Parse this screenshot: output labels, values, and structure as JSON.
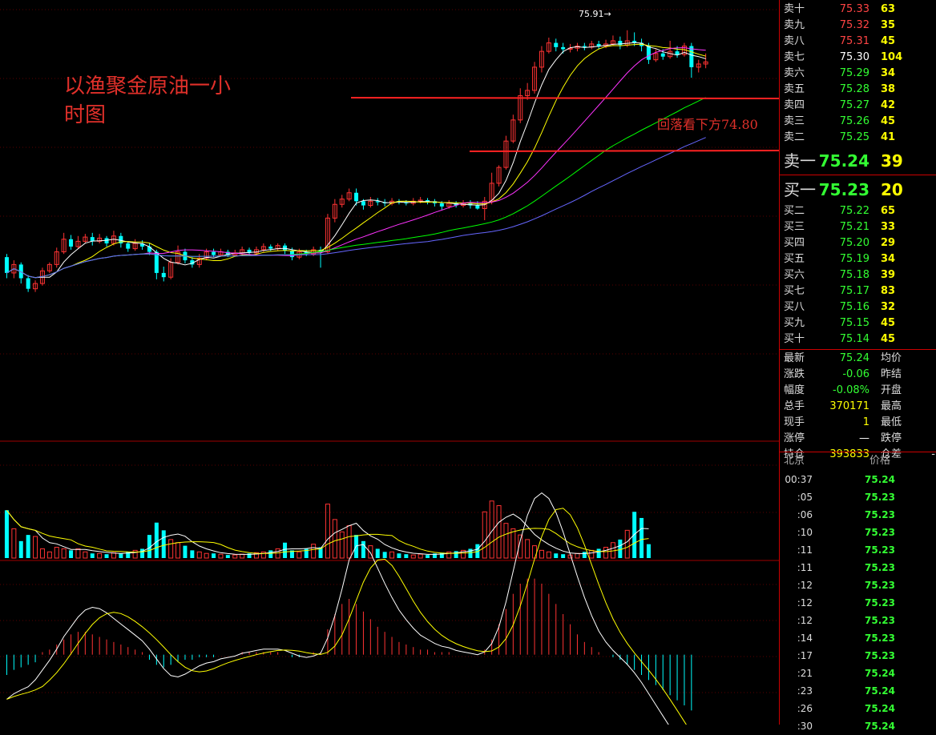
{
  "annotations": {
    "title": "以渔聚金原油一小\n时图",
    "note": "回落看下方74.80",
    "peak_label": "75.91→"
  },
  "colors": {
    "up": "#ff3333",
    "down": "#00ffff",
    "ma5": "#ffffff",
    "ma10": "#ffff00",
    "ma20": "#ff33ff",
    "ma40": "#00ff00",
    "ma60": "#6666ff",
    "arrow": "#ff2222"
  },
  "chart_data": [
    {
      "type": "candlestick",
      "name": "price",
      "candles": [
        [
          75.25,
          75.1,
          75.28,
          75.05
        ],
        [
          75.1,
          75.18,
          75.22,
          75.05
        ],
        [
          75.18,
          75.05,
          75.2,
          75.0
        ],
        [
          75.05,
          74.95,
          75.08,
          74.92
        ],
        [
          74.95,
          75.0,
          75.03,
          74.92
        ],
        [
          75.0,
          75.12,
          75.15,
          74.98
        ],
        [
          75.12,
          75.18,
          75.2,
          75.1
        ],
        [
          75.18,
          75.3,
          75.34,
          75.15
        ],
        [
          75.3,
          75.42,
          75.48,
          75.28
        ],
        [
          75.42,
          75.35,
          75.46,
          75.32
        ],
        [
          75.35,
          75.4,
          75.45,
          75.33
        ],
        [
          75.4,
          75.44,
          75.47,
          75.38
        ],
        [
          75.44,
          75.4,
          75.48,
          75.36
        ],
        [
          75.4,
          75.43,
          75.47,
          75.38
        ],
        [
          75.43,
          75.38,
          75.45,
          75.35
        ],
        [
          75.38,
          75.45,
          75.5,
          75.36
        ],
        [
          75.45,
          75.38,
          75.48,
          75.34
        ],
        [
          75.38,
          75.33,
          75.4,
          75.3
        ],
        [
          75.33,
          75.38,
          75.42,
          75.31
        ],
        [
          75.38,
          75.35,
          75.41,
          75.32
        ],
        [
          75.35,
          75.3,
          75.38,
          75.27
        ],
        [
          75.3,
          75.1,
          75.32,
          75.04
        ],
        [
          75.1,
          75.06,
          75.16,
          75.02
        ],
        [
          75.06,
          75.2,
          75.24,
          75.04
        ],
        [
          75.2,
          75.3,
          75.36,
          75.18
        ],
        [
          75.3,
          75.22,
          75.33,
          75.19
        ],
        [
          75.22,
          75.18,
          75.25,
          75.15
        ],
        [
          75.18,
          75.24,
          75.28,
          75.15
        ],
        [
          75.24,
          75.3,
          75.33,
          75.22
        ],
        [
          75.3,
          75.27,
          75.33,
          75.25
        ],
        [
          75.27,
          75.3,
          75.33,
          75.26
        ],
        [
          75.3,
          75.27,
          75.32,
          75.25
        ],
        [
          75.27,
          75.29,
          75.32,
          75.26
        ],
        [
          75.29,
          75.32,
          75.35,
          75.27
        ],
        [
          75.32,
          75.29,
          75.34,
          75.27
        ],
        [
          75.29,
          75.32,
          75.35,
          75.28
        ],
        [
          75.32,
          75.35,
          75.38,
          75.3
        ],
        [
          75.35,
          75.33,
          75.37,
          75.31
        ],
        [
          75.33,
          75.36,
          75.38,
          75.31
        ],
        [
          75.36,
          75.31,
          75.38,
          75.28
        ],
        [
          75.31,
          75.25,
          75.34,
          75.22
        ],
        [
          75.25,
          75.3,
          75.33,
          75.23
        ],
        [
          75.3,
          75.28,
          75.32,
          75.26
        ],
        [
          75.28,
          75.32,
          75.35,
          75.26
        ],
        [
          75.32,
          75.3,
          75.35,
          75.15
        ],
        [
          75.3,
          75.62,
          75.66,
          75.28
        ],
        [
          75.62,
          75.75,
          75.8,
          75.58
        ],
        [
          75.75,
          75.8,
          75.84,
          75.72
        ],
        [
          75.8,
          75.86,
          75.9,
          75.78
        ],
        [
          75.86,
          75.78,
          75.9,
          75.74
        ],
        [
          75.78,
          75.74,
          75.8,
          75.7
        ],
        [
          75.74,
          75.78,
          75.82,
          75.72
        ],
        [
          75.78,
          75.77,
          75.81,
          75.74
        ],
        [
          75.77,
          75.76,
          75.8,
          75.73
        ],
        [
          75.76,
          75.78,
          75.81,
          75.74
        ],
        [
          75.78,
          75.77,
          75.8,
          75.75
        ],
        [
          75.77,
          75.76,
          75.79,
          75.74
        ],
        [
          75.76,
          75.78,
          75.81,
          75.74
        ],
        [
          75.78,
          75.79,
          75.82,
          75.76
        ],
        [
          75.79,
          75.78,
          75.81,
          75.75
        ],
        [
          75.78,
          75.76,
          75.8,
          75.73
        ],
        [
          75.76,
          75.73,
          75.78,
          75.7
        ],
        [
          75.73,
          75.76,
          75.79,
          75.71
        ],
        [
          75.76,
          75.74,
          75.78,
          75.72
        ],
        [
          75.74,
          75.76,
          75.79,
          75.72
        ],
        [
          75.76,
          75.74,
          75.79,
          75.71
        ],
        [
          75.74,
          75.71,
          75.78,
          75.7
        ],
        [
          75.71,
          75.78,
          75.82,
          75.6
        ],
        [
          75.78,
          75.95,
          76.05,
          75.75
        ],
        [
          75.95,
          76.1,
          76.12,
          75.92
        ],
        [
          76.1,
          76.35,
          76.4,
          76.08
        ],
        [
          76.35,
          76.55,
          76.6,
          76.33
        ],
        [
          76.55,
          76.78,
          76.85,
          76.52
        ],
        [
          76.78,
          76.83,
          76.9,
          76.74
        ],
        [
          76.83,
          77.05,
          77.1,
          76.8
        ],
        [
          77.05,
          77.2,
          77.25,
          77.0
        ],
        [
          77.2,
          77.28,
          77.33,
          77.18
        ],
        [
          77.28,
          77.24,
          77.32,
          77.2
        ],
        [
          77.24,
          77.22,
          77.28,
          77.18
        ],
        [
          77.22,
          77.23,
          77.27,
          77.19
        ],
        [
          77.23,
          77.25,
          77.28,
          77.2
        ],
        [
          77.25,
          77.24,
          77.28,
          77.21
        ],
        [
          77.24,
          77.27,
          77.3,
          77.22
        ],
        [
          77.27,
          77.25,
          77.3,
          77.22
        ],
        [
          77.25,
          77.27,
          77.31,
          77.23
        ],
        [
          77.27,
          77.3,
          77.35,
          77.25
        ],
        [
          77.3,
          77.26,
          77.34,
          77.22
        ],
        [
          77.26,
          77.3,
          77.4,
          77.24
        ],
        [
          77.3,
          77.28,
          77.38,
          77.25
        ],
        [
          77.28,
          77.25,
          77.32,
          77.2
        ],
        [
          77.25,
          77.12,
          77.28,
          77.08
        ],
        [
          77.12,
          77.18,
          77.22,
          77.1
        ],
        [
          77.18,
          77.15,
          77.22,
          77.12
        ],
        [
          77.15,
          77.2,
          77.3,
          77.13
        ],
        [
          77.2,
          77.17,
          77.25,
          77.14
        ],
        [
          77.17,
          77.25,
          77.28,
          77.15
        ],
        [
          77.25,
          77.05,
          77.28,
          76.95
        ],
        [
          77.05,
          77.08,
          77.12,
          77.0
        ],
        [
          77.08,
          77.1,
          77.18,
          77.04
        ]
      ],
      "ylim": [
        74.5,
        77.55
      ],
      "peak_value": 75.91
    },
    {
      "type": "bar",
      "name": "volume",
      "values": [
        62,
        38,
        22,
        30,
        28,
        12,
        8,
        14,
        12,
        10,
        12,
        8,
        6,
        6,
        5,
        7,
        6,
        8,
        10,
        12,
        30,
        46,
        36,
        24,
        20,
        16,
        10,
        8,
        6,
        6,
        5,
        4,
        4,
        5,
        6,
        7,
        8,
        10,
        12,
        20,
        10,
        8,
        12,
        18,
        14,
        70,
        50,
        34,
        42,
        30,
        22,
        16,
        12,
        8,
        8,
        6,
        5,
        4,
        5,
        4,
        6,
        7,
        8,
        9,
        10,
        12,
        18,
        60,
        74,
        68,
        45,
        38,
        30,
        24,
        16,
        10,
        8,
        6,
        5,
        4,
        6,
        8,
        10,
        12,
        14,
        20,
        24,
        36,
        60,
        52,
        18
      ],
      "ylim": [
        0,
        80
      ]
    },
    {
      "type": "bar",
      "name": "macd",
      "values": [
        -8,
        -6,
        -5,
        -4,
        -3,
        1,
        2,
        4,
        6,
        8,
        9,
        9,
        8,
        7,
        6,
        5,
        4,
        3,
        2,
        1,
        -2,
        -4,
        -5,
        -4,
        -3,
        -2,
        -2,
        -1,
        -1,
        -1,
        0,
        0,
        0,
        1,
        1,
        1,
        1,
        1,
        1,
        0,
        -1,
        -1,
        0,
        1,
        1,
        10,
        16,
        20,
        22,
        20,
        17,
        14,
        11,
        9,
        7,
        5,
        4,
        3,
        2,
        2,
        1,
        1,
        1,
        0,
        0,
        0,
        0,
        2,
        6,
        12,
        18,
        24,
        28,
        30,
        30,
        28,
        24,
        20,
        16,
        12,
        8,
        5,
        3,
        1,
        0,
        -1,
        -2,
        -4,
        -6,
        -8,
        -10,
        -12,
        -14,
        -16,
        -18,
        -20,
        -22
      ],
      "ylim": [
        -26,
        34
      ]
    }
  ],
  "orderbook": {
    "asks": [
      {
        "label": "卖十",
        "price": "75.33",
        "vol": "63",
        "cls": "red"
      },
      {
        "label": "卖九",
        "price": "75.32",
        "vol": "35",
        "cls": "red"
      },
      {
        "label": "卖八",
        "price": "75.31",
        "vol": "45",
        "cls": "red"
      },
      {
        "label": "卖七",
        "price": "75.30",
        "vol": "104",
        "cls": "white"
      },
      {
        "label": "卖六",
        "price": "75.29",
        "vol": "34",
        "cls": "green"
      },
      {
        "label": "卖五",
        "price": "75.28",
        "vol": "38",
        "cls": "green"
      },
      {
        "label": "卖四",
        "price": "75.27",
        "vol": "42",
        "cls": "green"
      },
      {
        "label": "卖三",
        "price": "75.26",
        "vol": "45",
        "cls": "green"
      },
      {
        "label": "卖二",
        "price": "75.25",
        "vol": "41",
        "cls": "green"
      },
      {
        "label": "卖一",
        "price": "75.24",
        "vol": "39",
        "cls": "green"
      }
    ],
    "bids": [
      {
        "label": "买一",
        "price": "75.23",
        "vol": "20",
        "cls": "green"
      },
      {
        "label": "买二",
        "price": "75.22",
        "vol": "65",
        "cls": "green"
      },
      {
        "label": "买三",
        "price": "75.21",
        "vol": "33",
        "cls": "green"
      },
      {
        "label": "买四",
        "price": "75.20",
        "vol": "29",
        "cls": "green"
      },
      {
        "label": "买五",
        "price": "75.19",
        "vol": "34",
        "cls": "green"
      },
      {
        "label": "买六",
        "price": "75.18",
        "vol": "39",
        "cls": "green"
      },
      {
        "label": "买七",
        "price": "75.17",
        "vol": "83",
        "cls": "green"
      },
      {
        "label": "买八",
        "price": "75.16",
        "vol": "32",
        "cls": "green"
      },
      {
        "label": "买九",
        "price": "75.15",
        "vol": "45",
        "cls": "green"
      },
      {
        "label": "买十",
        "price": "75.14",
        "vol": "45",
        "cls": "green"
      }
    ]
  },
  "stats": [
    {
      "label": "最新",
      "value": "75.24",
      "cls": "green",
      "label2": "均价",
      "value2": ""
    },
    {
      "label": "涨跌",
      "value": "-0.06",
      "cls": "green",
      "label2": "昨结",
      "value2": ""
    },
    {
      "label": "幅度",
      "value": "-0.08%",
      "cls": "green",
      "label2": "开盘",
      "value2": ""
    },
    {
      "label": "总手",
      "value": "370171",
      "cls": "yellow",
      "label2": "最高",
      "value2": ""
    },
    {
      "label": "现手",
      "value": "1",
      "cls": "yellow",
      "label2": "最低",
      "value2": ""
    },
    {
      "label": "涨停",
      "value": "—",
      "cls": "white",
      "label2": "跌停",
      "value2": ""
    },
    {
      "label": "持仓",
      "value": "393833",
      "cls": "yellow",
      "label2": "仓差",
      "value2": "-"
    }
  ],
  "ticks": {
    "header_time": "北京",
    "header_price": "价格",
    "rows": [
      {
        "t": "00:37",
        "p": "75.24"
      },
      {
        "t": ":05",
        "p": "75.23"
      },
      {
        "t": ":06",
        "p": "75.23"
      },
      {
        "t": ":10",
        "p": "75.23"
      },
      {
        "t": ":11",
        "p": "75.23"
      },
      {
        "t": ":11",
        "p": "75.23"
      },
      {
        "t": ":12",
        "p": "75.23"
      },
      {
        "t": ":12",
        "p": "75.23"
      },
      {
        "t": ":12",
        "p": "75.23"
      },
      {
        "t": ":14",
        "p": "75.23"
      },
      {
        "t": ":17",
        "p": "75.23"
      },
      {
        "t": ":21",
        "p": "75.24"
      },
      {
        "t": ":23",
        "p": "75.24"
      },
      {
        "t": ":26",
        "p": "75.24"
      },
      {
        "t": ":30",
        "p": "75.24"
      }
    ]
  }
}
